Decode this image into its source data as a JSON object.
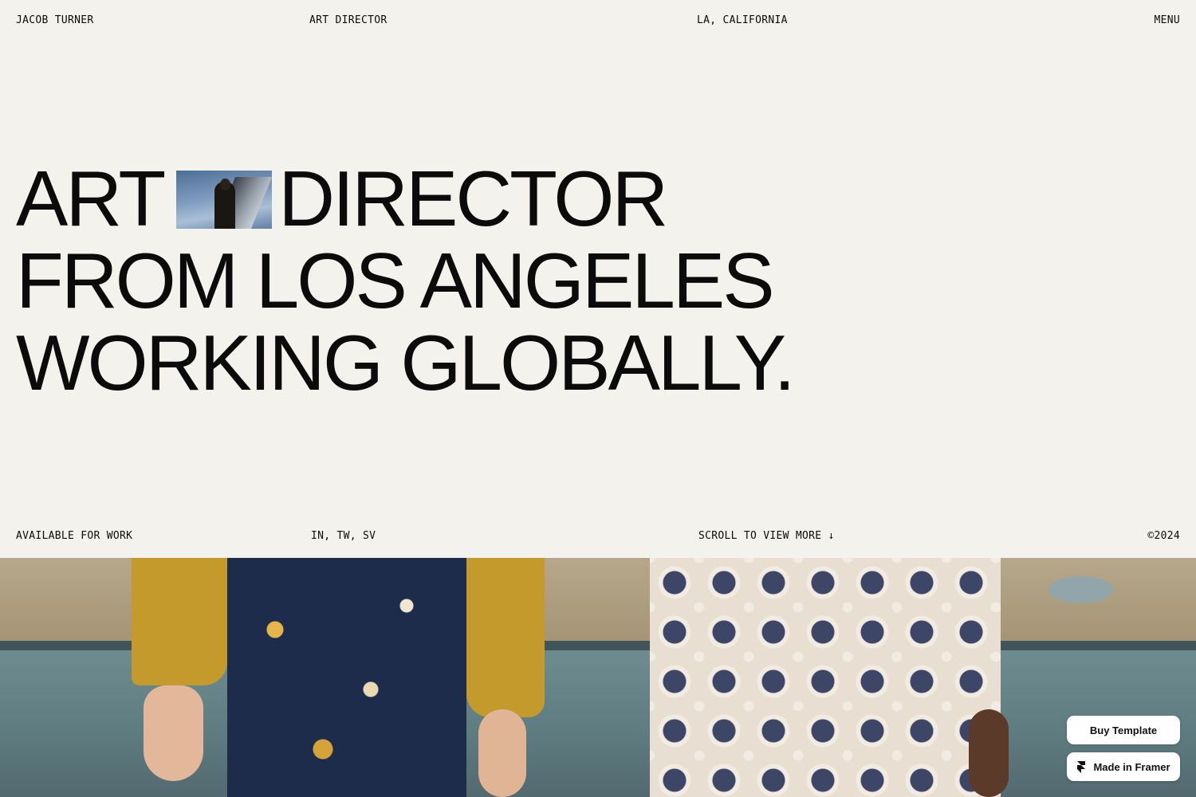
{
  "header": {
    "name": "JACOB TURNER",
    "role": "ART DIRECTOR",
    "location": "LA, CALIFORNIA",
    "menu_label": "MENU"
  },
  "hero": {
    "line1_left": "ART",
    "line1_right": "DIRECTOR",
    "line2": "FROM LOS ANGELES",
    "line3": "WORKING GLOBALLY."
  },
  "info_row": {
    "availability": "AVAILABLE FOR WORK",
    "social": "IN, TW, SV",
    "scroll_hint": "SCROLL TO VIEW MORE ↓",
    "copyright": "©2024"
  },
  "badges": {
    "buy_label": "Buy Template",
    "framer_label": "Made in Framer"
  },
  "colors": {
    "background": "#f4f2ec",
    "text": "#0b0b0b"
  },
  "icons": {
    "framer": "framer-logo-icon",
    "scroll": "arrow-down-icon"
  }
}
